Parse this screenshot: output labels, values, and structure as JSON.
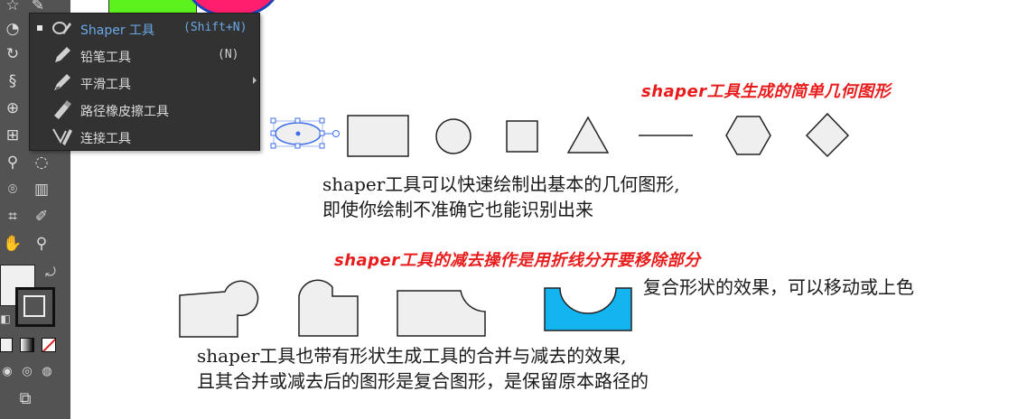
{
  "flyout": {
    "items": [
      {
        "label": "Shaper 工具",
        "shortcut": "(Shift+N)",
        "icon": "shaper-icon",
        "active": true
      },
      {
        "label": "铅笔工具",
        "shortcut": "(N)",
        "icon": "pencil-icon",
        "active": false
      },
      {
        "label": "平滑工具",
        "shortcut": "",
        "icon": "smooth-icon",
        "active": false
      },
      {
        "label": "路径橡皮擦工具",
        "shortcut": "",
        "icon": "path-eraser-icon",
        "active": false
      },
      {
        "label": "连接工具",
        "shortcut": "",
        "icon": "join-icon",
        "active": false
      }
    ]
  },
  "annotations": {
    "title1": "shaper工具生成的简单几何图形",
    "desc1_line1": "shaper工具可以快速绘制出基本的几何图形,",
    "desc1_line2": "即使你绘制不准确它也能识别出来",
    "title2": "shaper工具的减去操作是用折线分开要移除部分",
    "desc2": "复合形状的效果，可以移动或上色",
    "desc3_line1": "shaper工具也带有形状生成工具的合并与减去的效果,",
    "desc3_line2": "且其合并或减去后的图形是复合图形，是保留原本路径的"
  },
  "colors": {
    "toolbar_bg": "#535353",
    "flyout_bg": "#323232",
    "title_red": "#e81c1c",
    "compound_fill": "#12b5f0",
    "shape_fill": "#efefef",
    "selection_blue": "#3d6ee8"
  }
}
